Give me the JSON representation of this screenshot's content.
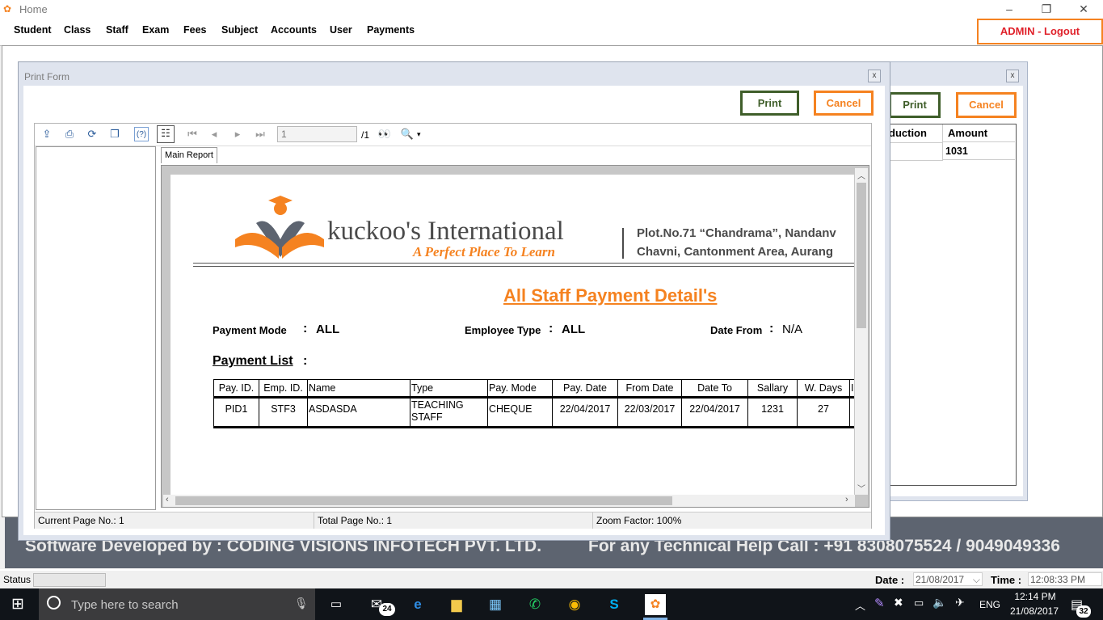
{
  "window": {
    "title": "Home",
    "minimize": "–",
    "maximize": "❐",
    "close": "✕"
  },
  "menu": {
    "items": [
      "Student",
      "Class",
      "Staff",
      "Exam",
      "Fees",
      "Subject",
      "Accounts",
      "User",
      "Payments"
    ],
    "logout": "ADMIN - Logout"
  },
  "back_window": {
    "close": "x",
    "print": "Print",
    "cancel": "Cancel",
    "headers": [
      "duction",
      "Amount"
    ],
    "amount": "1031"
  },
  "print_form": {
    "title": "Print Form",
    "close": "x",
    "print": "Print",
    "cancel": "Cancel",
    "toolbar": {
      "page_input": "1",
      "page_total": "/1"
    },
    "tab": "Main Report",
    "status": {
      "current_page": "Current Page No.: 1",
      "total_page": "Total Page No.: 1",
      "zoom": "Zoom Factor: 100%"
    }
  },
  "report": {
    "company": "kuckoo's International",
    "tagline": "A Perfect Place To Learn",
    "address1": "Plot.No.71 “Chandrama”, Nandanv",
    "address2": "Chavni, Cantonment Area, Aurang",
    "title": "All Staff Payment Detail's",
    "payment_mode_label": "Payment Mode",
    "payment_mode": "ALL",
    "employee_type_label": "Employee Type",
    "employee_type": "ALL",
    "date_from_label": "Date From",
    "date_from": "N/A",
    "colon": ":",
    "payment_list_label": "Payment List",
    "table": {
      "headers": [
        "Pay. ID.",
        "Emp. ID.",
        "Name",
        "Type",
        "Pay. Mode",
        "Pay. Date",
        "From Date",
        "Date To",
        "Sallary",
        "W. Days",
        "I"
      ],
      "rows": [
        [
          "PID1",
          "STF3",
          "ASDASDA",
          "TEACHING STAFF",
          "CHEQUE",
          "22/04/2017",
          "22/03/2017",
          "22/04/2017",
          "1231",
          "27",
          ""
        ]
      ]
    }
  },
  "footer": {
    "developer": "Software Developed by : CODING VISIONS INFOTECH PVT. LTD.",
    "help": "For any Technical Help Call : +91 8308075524 / 9049049336"
  },
  "statusbar": {
    "status_label": "Status",
    "date_label": "Date :",
    "date_value": "21/08/2017",
    "time_label": "Time :",
    "time_value": "12:08:33 PM"
  },
  "taskbar": {
    "search_placeholder": "Type here to search",
    "mail_badge": "24",
    "lang": "ENG",
    "clock_time": "12:14 PM",
    "clock_date": "21/08/2017",
    "notify_badge": "32"
  },
  "colors": {
    "accent_orange": "#f58220",
    "print_green": "#3f5e2a",
    "logout_red": "#e0212a",
    "footer_gray": "#5d6470"
  }
}
